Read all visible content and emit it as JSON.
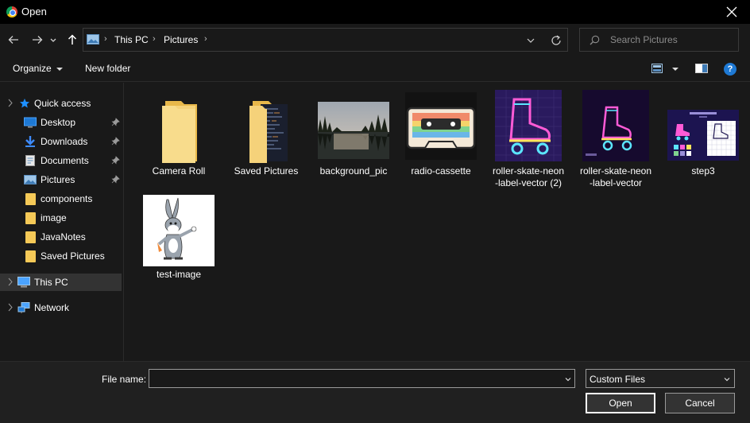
{
  "window": {
    "title": "Open",
    "app_icon": "chrome-icon",
    "close_icon": "close-icon"
  },
  "nav": {
    "back_icon": "arrow-left-icon",
    "forward_icon": "arrow-right-icon",
    "recent_icon": "chevron-down-icon",
    "up_icon": "arrow-up-icon",
    "breadcrumbs": [
      "This PC",
      "Pictures"
    ],
    "search_placeholder": "Search Pictures"
  },
  "toolbar": {
    "organize_label": "Organize",
    "new_folder_label": "New folder",
    "help_label": "?"
  },
  "sidebar": {
    "items": [
      {
        "label": "Quick access",
        "icon": "star-icon",
        "pinned": false
      },
      {
        "label": "Desktop",
        "icon": "desktop-icon",
        "pinned": true
      },
      {
        "label": "Downloads",
        "icon": "download-icon",
        "pinned": true
      },
      {
        "label": "Documents",
        "icon": "document-icon",
        "pinned": true
      },
      {
        "label": "Pictures",
        "icon": "pictures-icon",
        "pinned": true
      },
      {
        "label": "components",
        "icon": "folder-icon",
        "pinned": false
      },
      {
        "label": "image",
        "icon": "folder-icon",
        "pinned": false
      },
      {
        "label": "JavaNotes",
        "icon": "folder-icon",
        "pinned": false
      },
      {
        "label": "Saved Pictures",
        "icon": "folder-icon",
        "pinned": false
      },
      {
        "label": "This PC",
        "icon": "computer-icon",
        "selected": true
      },
      {
        "label": "Network",
        "icon": "network-icon",
        "pinned": false
      }
    ]
  },
  "files": [
    {
      "name": "Camera Roll",
      "kind": "folder"
    },
    {
      "name": "Saved Pictures",
      "kind": "folder"
    },
    {
      "name": "background_pic",
      "kind": "image"
    },
    {
      "name": "radio-cassette",
      "kind": "image"
    },
    {
      "name_line1": "roller-skate-neon",
      "name_line2": "-label-vector (2)",
      "kind": "image"
    },
    {
      "name_line1": "roller-skate-neon",
      "name_line2": "-label-vector",
      "kind": "image"
    },
    {
      "name": "step3",
      "kind": "image"
    },
    {
      "name": "test-image",
      "kind": "image"
    }
  ],
  "footer": {
    "file_name_label": "File name:",
    "file_name_value": "",
    "file_type": "Custom Files",
    "open_label": "Open",
    "cancel_label": "Cancel"
  },
  "colors": {
    "background": "#191919",
    "titlebar": "#000000",
    "footer": "#202020",
    "selection": "#333333",
    "folder": "#f5c957",
    "accent": "#1e79d4"
  }
}
